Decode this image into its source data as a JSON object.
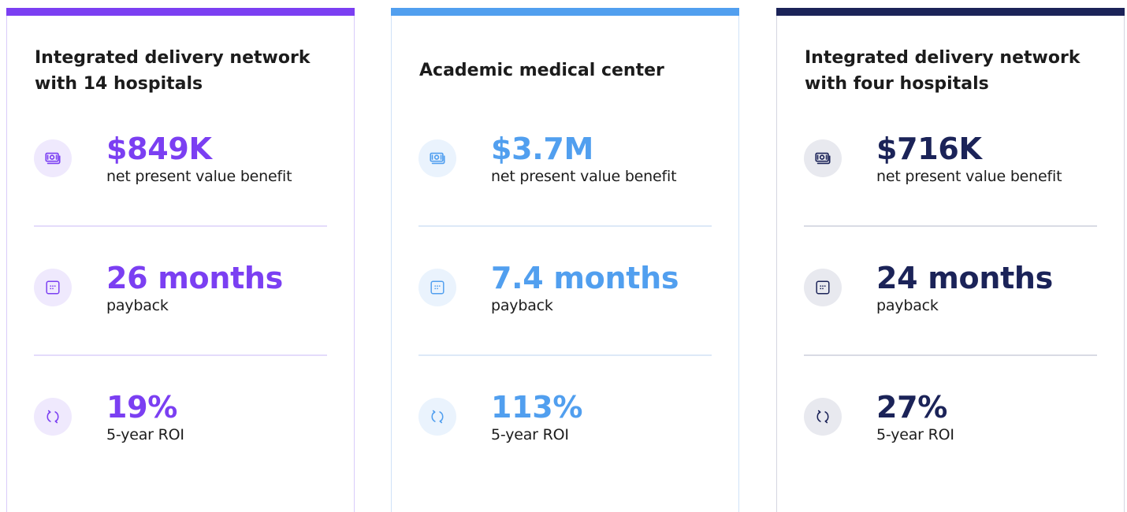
{
  "cards": [
    {
      "title": "Integrated delivery network with 14 hospitals",
      "accent": "#7b3ff2",
      "icon_bg": "#efe9fd",
      "border": "#d9ccfa",
      "divider": "#e4dcfb",
      "metrics": [
        {
          "icon": "money-icon",
          "value": "$849K",
          "label": "net present value benefit"
        },
        {
          "icon": "calendar-icon",
          "value": "26 months",
          "label": "payback"
        },
        {
          "icon": "refresh-icon",
          "value": "19%",
          "label": "5-year ROI"
        }
      ]
    },
    {
      "title": "Academic medical center",
      "accent": "#519fef",
      "icon_bg": "#eaf3fd",
      "border": "#cfe2f8",
      "divider": "#dde9f7",
      "metrics": [
        {
          "icon": "money-icon",
          "value": "$3.7M",
          "label": "net present value benefit"
        },
        {
          "icon": "calendar-icon",
          "value": "7.4 months",
          "label": "payback"
        },
        {
          "icon": "refresh-icon",
          "value": "113%",
          "label": "5-year ROI"
        }
      ]
    },
    {
      "title": "Integrated delivery network with four hospitals",
      "accent": "#1b2358",
      "icon_bg": "#e8e9ef",
      "border": "#d4d6e1",
      "divider": "#d9dbe4",
      "metrics": [
        {
          "icon": "money-icon",
          "value": "$716K",
          "label": "net present value benefit"
        },
        {
          "icon": "calendar-icon",
          "value": "24 months",
          "label": "payback"
        },
        {
          "icon": "refresh-icon",
          "value": "27%",
          "label": "5-year ROI"
        }
      ]
    }
  ]
}
